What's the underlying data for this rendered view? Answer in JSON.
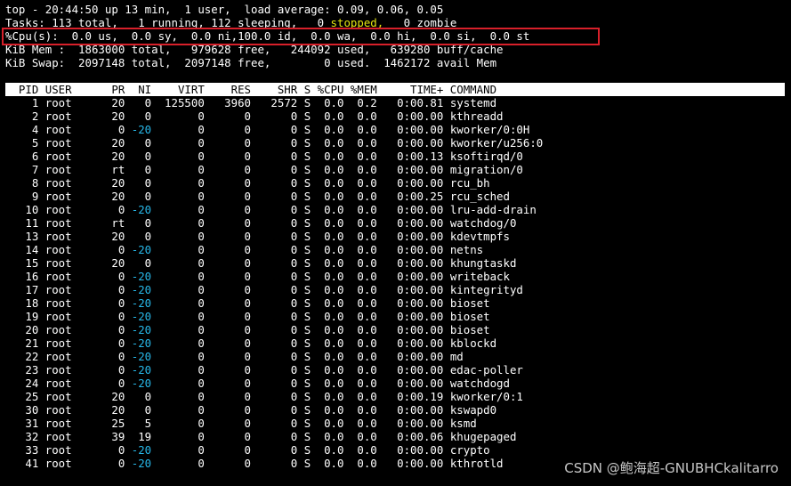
{
  "summary": {
    "top_line": "top - 20:44:50 up 13 min,  1 user,  load average: 0.09, 0.06, 0.05",
    "tasks_pre": "Tasks: 113 total,   1 running, 112 sleeping,   0 ",
    "tasks_stopped": "stopped,",
    "tasks_post": "   0 zombie",
    "cpu_line": "%Cpu(s):  0.0 us,  0.0 sy,  0.0 ni,100.0 id,  0.0 wa,  0.0 hi,  0.0 si,  0.0 st",
    "mem_line": "KiB Mem :  1863000 total,   979628 free,   244092 used,   639280 buff/cache",
    "swap_line": "KiB Swap:  2097148 total,  2097148 free,        0 used.  1462172 avail Mem"
  },
  "table": {
    "header": "  PID USER      PR  NI    VIRT    RES    SHR S %CPU %MEM     TIME+ COMMAND",
    "rows": [
      {
        "pre": "    1 root      20",
        "ni": "   0",
        "post": "  125500   3960   2572 S  0.0  0.2   0:00.81 systemd",
        "neg": false
      },
      {
        "pre": "    2 root      20",
        "ni": "   0",
        "post": "       0      0      0 S  0.0  0.0   0:00.00 kthreadd",
        "neg": false
      },
      {
        "pre": "    4 root       0",
        "ni": " -20",
        "post": "       0      0      0 S  0.0  0.0   0:00.00 kworker/0:0H",
        "neg": true
      },
      {
        "pre": "    5 root      20",
        "ni": "   0",
        "post": "       0      0      0 S  0.0  0.0   0:00.00 kworker/u256:0",
        "neg": false
      },
      {
        "pre": "    6 root      20",
        "ni": "   0",
        "post": "       0      0      0 S  0.0  0.0   0:00.13 ksoftirqd/0",
        "neg": false
      },
      {
        "pre": "    7 root      rt",
        "ni": "   0",
        "post": "       0      0      0 S  0.0  0.0   0:00.00 migration/0",
        "neg": false
      },
      {
        "pre": "    8 root      20",
        "ni": "   0",
        "post": "       0      0      0 S  0.0  0.0   0:00.00 rcu_bh",
        "neg": false
      },
      {
        "pre": "    9 root      20",
        "ni": "   0",
        "post": "       0      0      0 S  0.0  0.0   0:00.25 rcu_sched",
        "neg": false
      },
      {
        "pre": "   10 root       0",
        "ni": " -20",
        "post": "       0      0      0 S  0.0  0.0   0:00.00 lru-add-drain",
        "neg": true
      },
      {
        "pre": "   11 root      rt",
        "ni": "   0",
        "post": "       0      0      0 S  0.0  0.0   0:00.00 watchdog/0",
        "neg": false
      },
      {
        "pre": "   13 root      20",
        "ni": "   0",
        "post": "       0      0      0 S  0.0  0.0   0:00.00 kdevtmpfs",
        "neg": false
      },
      {
        "pre": "   14 root       0",
        "ni": " -20",
        "post": "       0      0      0 S  0.0  0.0   0:00.00 netns",
        "neg": true
      },
      {
        "pre": "   15 root      20",
        "ni": "   0",
        "post": "       0      0      0 S  0.0  0.0   0:00.00 khungtaskd",
        "neg": false
      },
      {
        "pre": "   16 root       0",
        "ni": " -20",
        "post": "       0      0      0 S  0.0  0.0   0:00.00 writeback",
        "neg": true
      },
      {
        "pre": "   17 root       0",
        "ni": " -20",
        "post": "       0      0      0 S  0.0  0.0   0:00.00 kintegrityd",
        "neg": true
      },
      {
        "pre": "   18 root       0",
        "ni": " -20",
        "post": "       0      0      0 S  0.0  0.0   0:00.00 bioset",
        "neg": true
      },
      {
        "pre": "   19 root       0",
        "ni": " -20",
        "post": "       0      0      0 S  0.0  0.0   0:00.00 bioset",
        "neg": true
      },
      {
        "pre": "   20 root       0",
        "ni": " -20",
        "post": "       0      0      0 S  0.0  0.0   0:00.00 bioset",
        "neg": true
      },
      {
        "pre": "   21 root       0",
        "ni": " -20",
        "post": "       0      0      0 S  0.0  0.0   0:00.00 kblockd",
        "neg": true
      },
      {
        "pre": "   22 root       0",
        "ni": " -20",
        "post": "       0      0      0 S  0.0  0.0   0:00.00 md",
        "neg": true
      },
      {
        "pre": "   23 root       0",
        "ni": " -20",
        "post": "       0      0      0 S  0.0  0.0   0:00.00 edac-poller",
        "neg": true
      },
      {
        "pre": "   24 root       0",
        "ni": " -20",
        "post": "       0      0      0 S  0.0  0.0   0:00.00 watchdogd",
        "neg": true
      },
      {
        "pre": "   25 root      20",
        "ni": "   0",
        "post": "       0      0      0 S  0.0  0.0   0:00.19 kworker/0:1",
        "neg": false
      },
      {
        "pre": "   30 root      20",
        "ni": "   0",
        "post": "       0      0      0 S  0.0  0.0   0:00.00 kswapd0",
        "neg": false
      },
      {
        "pre": "   31 root      25",
        "ni": "   5",
        "post": "       0      0      0 S  0.0  0.0   0:00.00 ksmd",
        "neg": false
      },
      {
        "pre": "   32 root      39",
        "ni": "  19",
        "post": "       0      0      0 S  0.0  0.0   0:00.06 khugepaged",
        "neg": false
      },
      {
        "pre": "   33 root       0",
        "ni": " -20",
        "post": "       0      0      0 S  0.0  0.0   0:00.00 crypto",
        "neg": true
      },
      {
        "pre": "   41 root       0",
        "ni": " -20",
        "post": "       0      0      0 S  0.0  0.0   0:00.00 kthrotld",
        "neg": true
      }
    ]
  },
  "watermark": "CSDN @鲍海超-GNUBHCkalitarro",
  "colors": {
    "highlight_box": "#d8202a",
    "stopped": "#e5e510",
    "negative_ni": "#27b7e8"
  }
}
